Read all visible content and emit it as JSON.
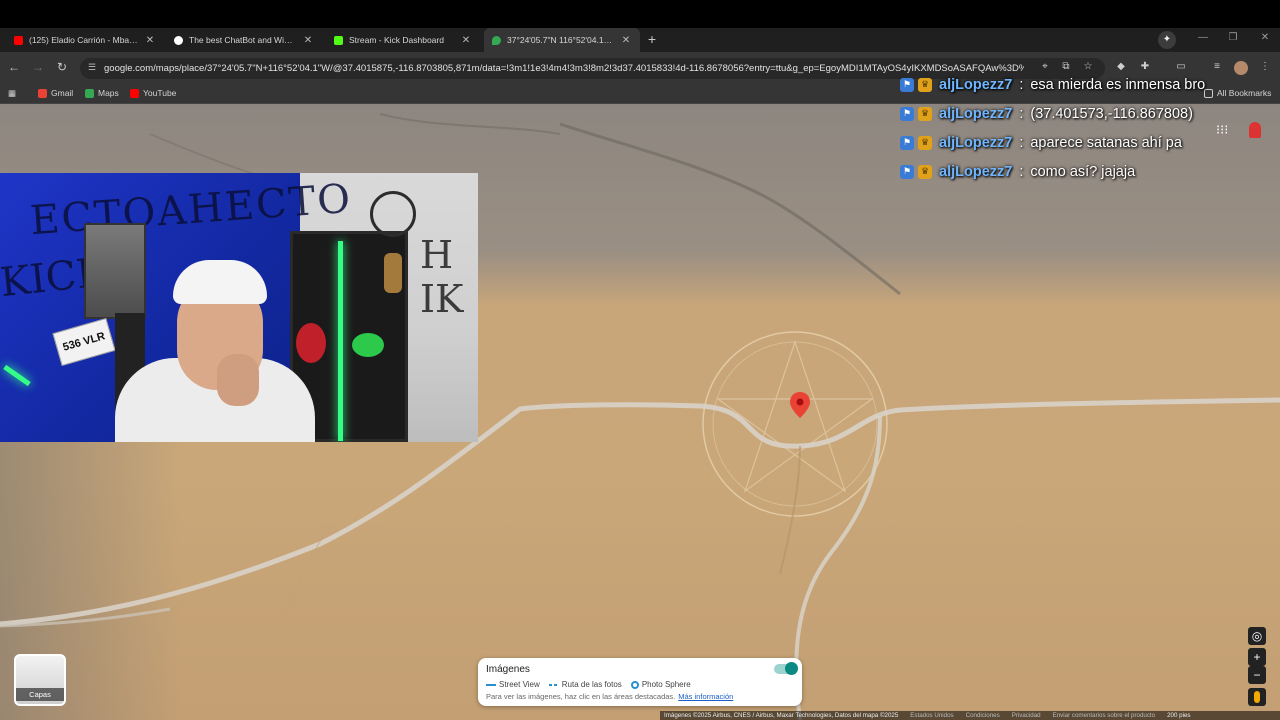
{
  "browser": {
    "tabs": [
      {
        "title": "(125) Eladio Carrión - Mbappe",
        "favicon_color": "#ff0000",
        "active": false
      },
      {
        "title": "The best ChatBot and Widgets",
        "favicon_color": "#ffffff",
        "active": false
      },
      {
        "title": "Stream - Kick Dashboard",
        "favicon_color": "#53fc18",
        "active": false
      },
      {
        "title": "37°24'05.7\"N 116°52'04.1\"W - G",
        "favicon_color": "#34a853",
        "active": true
      }
    ],
    "new_tab_label": "+",
    "url": "google.com/maps/place/37°24'05.7\"N+116°52'04.1\"W/@37.4015875,-116.8703805,871m/data=!3m1!1e3!4m4!3m3!8m2!3d37.4015833!4d-116.8678056?entry=ttu&g_ep=EgoyMDI1MTAyOS4yIKXMDSoASAFQAw%3D%3D",
    "bookmarks": [
      {
        "label": "Gmail",
        "color": "#ea4335"
      },
      {
        "label": "Maps",
        "color": "#34a853"
      },
      {
        "label": "YouTube",
        "color": "#ff0000"
      }
    ],
    "all_bookmarks": "All Bookmarks"
  },
  "chat": [
    {
      "user": "aljLopezz7",
      "message": "esa mierda es inmensa bro"
    },
    {
      "user": "aljLopezz7",
      "message": "(37.401573,-116.867808)"
    },
    {
      "user": "aljLopezz7",
      "message": "aparece satanas ahí pa"
    },
    {
      "user": "aljLopezz7",
      "message": "como así? jajaja"
    }
  ],
  "chat_separator": ":",
  "webcam": {
    "plate_text": "536 VLR"
  },
  "map": {
    "layers_label": "Capas",
    "image_panel": {
      "title": "Imágenes",
      "legend": [
        "Street View",
        "Ruta de las fotos",
        "Photo Sphere"
      ],
      "hint": "Para ver las imágenes, haz clic en las áreas destacadas.",
      "link": "Más información"
    },
    "attribution": {
      "imagery": "Imágenes ©2025 Airbus, CNES / Airbus, Maxar Technologies, Datos del mapa ©2025",
      "country": "Estados Unidos",
      "terms": "Condiciones",
      "privacy": "Privacidad",
      "feedback": "Enviar comentarios sobre el producto",
      "scale": "200 pies"
    },
    "pin_color": "#ea4335"
  }
}
